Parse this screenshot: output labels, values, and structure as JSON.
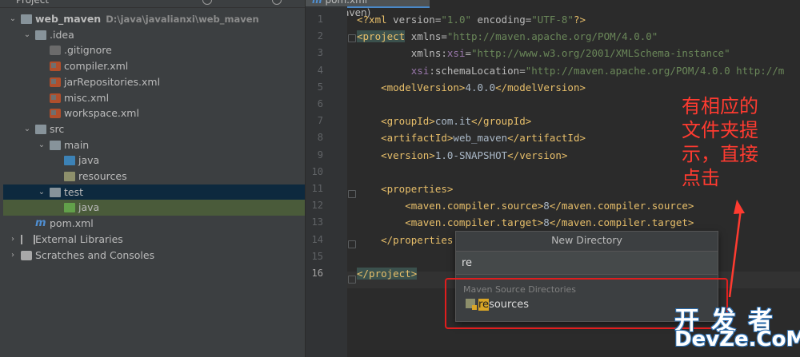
{
  "panel": {
    "title": "Project"
  },
  "tree": [
    {
      "label": "web_maven",
      "path": "D:\\java\\javalianxi\\web_maven",
      "icon": "module-folder-icon"
    },
    {
      "label": ".idea",
      "icon": "folder-icon"
    },
    {
      "label": ".gitignore",
      "icon": "gitignore-file-icon"
    },
    {
      "label": "compiler.xml",
      "icon": "xml-file-icon"
    },
    {
      "label": "jarRepositories.xml",
      "icon": "xml-file-icon"
    },
    {
      "label": "misc.xml",
      "icon": "xml-file-icon"
    },
    {
      "label": "workspace.xml",
      "icon": "xml-file-icon"
    },
    {
      "label": "src",
      "icon": "folder-icon"
    },
    {
      "label": "main",
      "icon": "folder-icon"
    },
    {
      "label": "java",
      "icon": "source-folder-icon"
    },
    {
      "label": "resources",
      "icon": "resources-folder-icon"
    },
    {
      "label": "test",
      "icon": "folder-icon"
    },
    {
      "label": "java",
      "icon": "test-source-folder-icon"
    },
    {
      "label": "pom.xml",
      "icon": "maven-file-icon"
    },
    {
      "label": "External Libraries",
      "icon": "library-icon"
    },
    {
      "label": "Scratches and Consoles",
      "icon": "scratches-icon"
    }
  ],
  "editor": {
    "tab_label": "pom.xml (web_maven)",
    "line_numbers": [
      "1",
      "2",
      "3",
      "4",
      "5",
      "6",
      "7",
      "8",
      "9",
      "10",
      "11",
      "12",
      "13",
      "14",
      "15",
      "16"
    ],
    "lines": [
      {
        "n": 1,
        "parts": [
          [
            "tag",
            "<?xml "
          ],
          [
            "attr",
            "version="
          ],
          [
            "str",
            "\"1.0\""
          ],
          [
            "attr",
            " encoding="
          ],
          [
            "str",
            "\"UTF-8\""
          ],
          [
            "tag",
            "?>"
          ]
        ]
      },
      {
        "n": 2,
        "parts": [
          [
            "tag",
            "<project"
          ],
          [
            "attr",
            " xmlns="
          ],
          [
            "str",
            "\"http://maven.apache.org/POM/4.0.0\""
          ]
        ]
      },
      {
        "n": 3,
        "parts": [
          [
            "attr",
            "         xmlns:"
          ],
          [
            "ns",
            "xsi"
          ],
          [
            "attr",
            "="
          ],
          [
            "str",
            "\"http://www.w3.org/2001/XMLSchema-instance\""
          ]
        ]
      },
      {
        "n": 4,
        "parts": [
          [
            "attr",
            "         "
          ],
          [
            "ns",
            "xsi"
          ],
          [
            "attr",
            ":schemaLocation="
          ],
          [
            "str",
            "\"http://maven.apache.org/POM/4.0.0 http://m"
          ]
        ]
      },
      {
        "n": 5,
        "parts": [
          [
            "tag",
            "    <modelVersion>"
          ],
          [
            "text",
            "4.0.0"
          ],
          [
            "tag",
            "</modelVersion>"
          ]
        ]
      },
      {
        "n": 7,
        "parts": [
          [
            "tag",
            "    <groupId>"
          ],
          [
            "text",
            "com.it"
          ],
          [
            "tag",
            "</groupId>"
          ]
        ]
      },
      {
        "n": 8,
        "parts": [
          [
            "tag",
            "    <artifactId>"
          ],
          [
            "text",
            "web_maven"
          ],
          [
            "tag",
            "</artifactId>"
          ]
        ]
      },
      {
        "n": 9,
        "parts": [
          [
            "tag",
            "    <version>"
          ],
          [
            "text",
            "1.0-SNAPSHOT"
          ],
          [
            "tag",
            "</version>"
          ]
        ]
      },
      {
        "n": 11,
        "parts": [
          [
            "tag",
            "    <properties>"
          ]
        ]
      },
      {
        "n": 12,
        "parts": [
          [
            "tag",
            "        <maven.compiler.source>"
          ],
          [
            "text",
            "8"
          ],
          [
            "tag",
            "</maven.compiler.source>"
          ]
        ]
      },
      {
        "n": 13,
        "parts": [
          [
            "tag",
            "        <maven.compiler.target>"
          ],
          [
            "text",
            "8"
          ],
          [
            "tag",
            "</maven.compiler.target>"
          ]
        ]
      },
      {
        "n": 14,
        "parts": [
          [
            "tag",
            "    </properties"
          ]
        ]
      },
      {
        "n": 16,
        "parts": [
          [
            "tag",
            "</project>"
          ]
        ]
      }
    ]
  },
  "annotation": {
    "lines": [
      "有相应的",
      "文件夹提",
      "示，直接",
      "点击"
    ]
  },
  "popup": {
    "title": "New Directory",
    "input_value": "re",
    "section_label": "Maven Source Directories",
    "item_match": "re",
    "item_rest": "sources"
  },
  "watermark": {
    "line1": "开发者",
    "line2": "DevZe.CoM"
  },
  "colors": {
    "accent": "#4a88c7",
    "annotation": "#ff3b30",
    "match_highlight": "#d9a526"
  }
}
